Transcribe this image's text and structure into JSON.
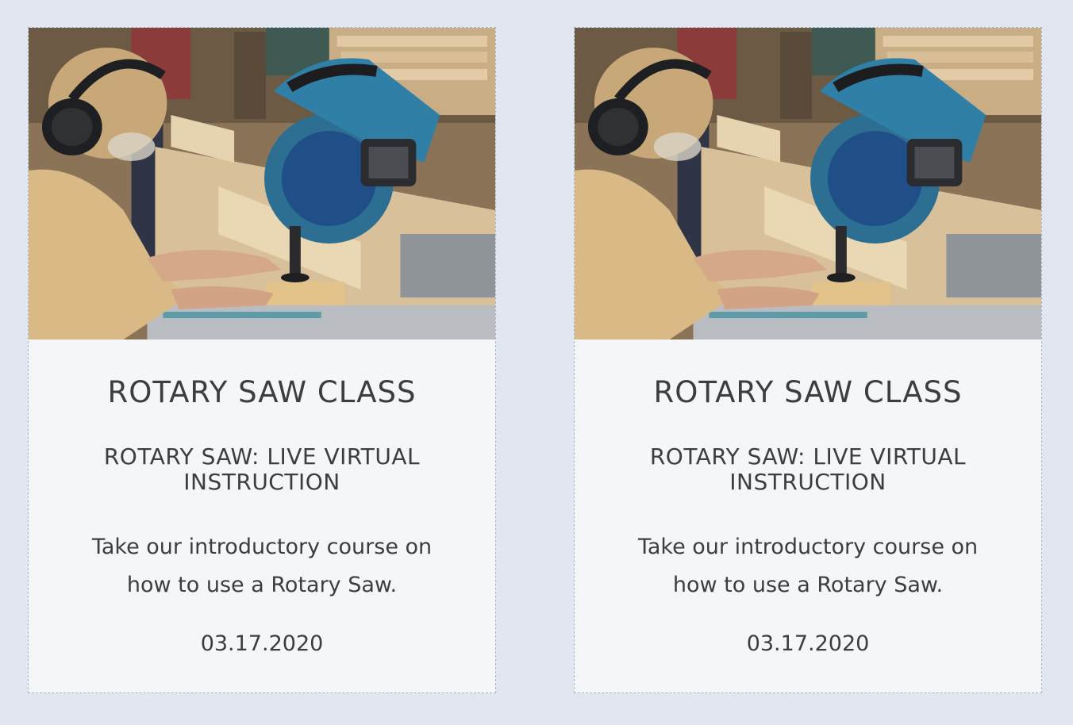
{
  "cards": [
    {
      "image_alt": "Woman wearing ear protection and safety glasses cutting a board with a blue miter saw in a workshop",
      "title": "ROTARY SAW CLASS",
      "subtitle": "ROTARY SAW: LIVE VIRTUAL INSTRUCTION",
      "description": "Take our introductory course on how to use a Rotary Saw.",
      "date": "03.17.2020"
    },
    {
      "image_alt": "Woman wearing ear protection and safety glasses cutting a board with a blue miter saw in a workshop",
      "title": "ROTARY SAW CLASS",
      "subtitle": "ROTARY SAW: LIVE VIRTUAL INSTRUCTION",
      "description": "Take our introductory course on how to use a Rotary Saw.",
      "date": "03.17.2020"
    }
  ],
  "colors": {
    "page_background": "#e2e6ef",
    "card_background": "#f5f6f8",
    "card_border": "#9db6cf",
    "text": "#3c3d42",
    "saw_blue": "#2f7fa6"
  }
}
